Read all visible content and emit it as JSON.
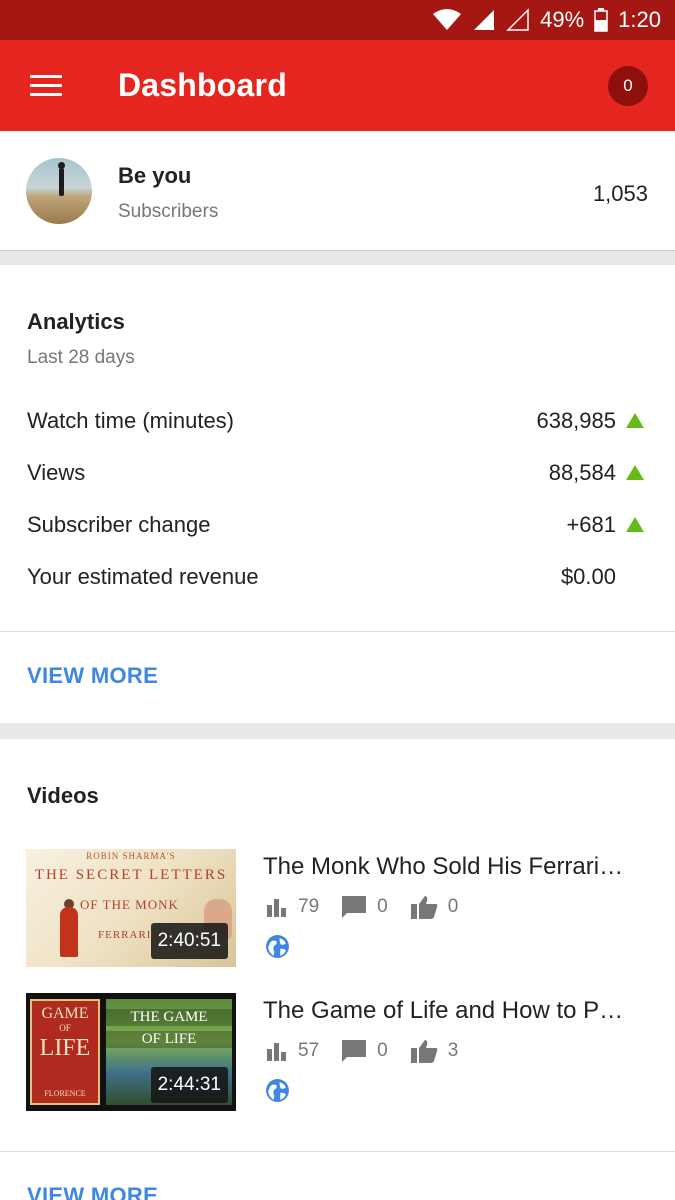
{
  "status_bar": {
    "battery": "49%",
    "time": "1:20"
  },
  "app_bar": {
    "title": "Dashboard",
    "notification_count": "0"
  },
  "channel": {
    "name": "Be you",
    "subscribers_label": "Subscribers",
    "subscriber_count": "1,053"
  },
  "analytics": {
    "title": "Analytics",
    "period": "Last 28 days",
    "metrics": [
      {
        "label": "Watch time (minutes)",
        "value": "638,985",
        "trend": "up"
      },
      {
        "label": "Views",
        "value": "88,584",
        "trend": "up"
      },
      {
        "label": "Subscriber change",
        "value": "+681",
        "trend": "up"
      },
      {
        "label": "Your estimated revenue",
        "value": "$0.00",
        "trend": "none"
      }
    ],
    "view_more": "VIEW MORE"
  },
  "videos": {
    "title": "Videos",
    "items": [
      {
        "title": "The Monk Who Sold His Ferrari…",
        "duration": "2:40:51",
        "views": "79",
        "comments": "0",
        "likes": "0",
        "visibility_icon": "globe-icon",
        "thumb": {
          "author": "ROBIN SHARMA'S",
          "title": "THE SECRET LETTERS",
          "mid": "OF THE MONK",
          "low": "FERRARI"
        }
      },
      {
        "title": "The Game of Life and How to P…",
        "duration": "2:44:31",
        "views": "57",
        "comments": "0",
        "likes": "3",
        "visibility_icon": "globe-icon",
        "thumb": {
          "book_top": "GAME",
          "book_mid": "OF",
          "book_big": "LIFE",
          "author": "FLORENCE",
          "scene_title": "THE GAME",
          "scene_sub": "OF LIFE"
        }
      }
    ],
    "view_more": "VIEW MORE"
  },
  "colors": {
    "status_bar": "#a51712",
    "app_bar": "#e52620",
    "badge": "#8e0f0b",
    "trend_up": "#66bb1a",
    "link": "#3f87e4",
    "globe": "#3f87e4"
  }
}
